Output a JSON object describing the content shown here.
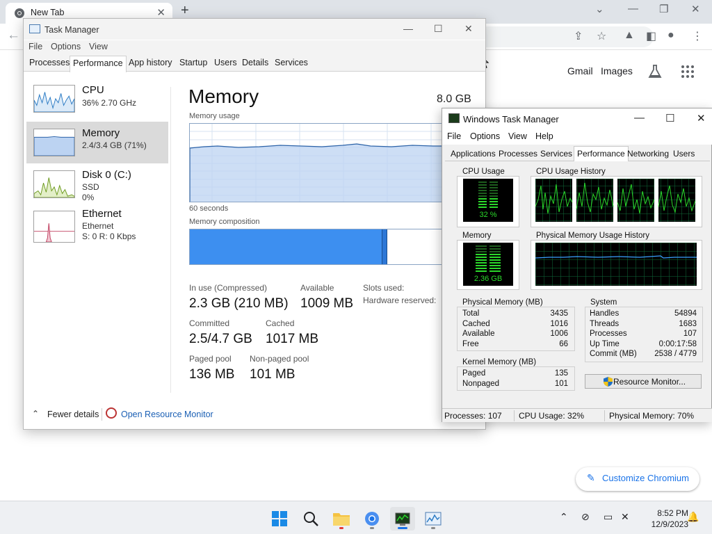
{
  "browser": {
    "tab_title": "New Tab",
    "gmail": "Gmail",
    "images": "Images",
    "customize": "Customize Chromium"
  },
  "taskbar": {
    "time": "8:52 PM",
    "date": "12/9/2023"
  },
  "tm": {
    "title": "Task Manager",
    "menu": [
      "File",
      "Options",
      "View"
    ],
    "tabs": [
      "Processes",
      "Performance",
      "App history",
      "Startup",
      "Users",
      "Details",
      "Services"
    ],
    "active_tab": "Performance",
    "sidebar": [
      {
        "name": "CPU",
        "line1": "36%  2.70 GHz",
        "line2": ""
      },
      {
        "name": "Memory",
        "line1": "2.4/3.4 GB (71%)",
        "line2": ""
      },
      {
        "name": "Disk 0 (C:)",
        "line1": "SSD",
        "line2": "0%"
      },
      {
        "name": "Ethernet",
        "line1": "Ethernet",
        "line2": "S: 0  R: 0 Kbps"
      }
    ],
    "memory": {
      "title": "Memory",
      "total": "8.0 GB",
      "usage_label": "Memory usage",
      "seconds_label": "60 seconds",
      "composition_label": "Memory composition",
      "in_use_label": "In use (Compressed)",
      "in_use_value": "2.3 GB (210 MB)",
      "available_label": "Available",
      "available_value": "1009 MB",
      "slots_label": "Slots used:",
      "hw_reserved_label": "Hardware reserved:",
      "committed_label": "Committed",
      "committed_value": "2.5/4.7 GB",
      "cached_label": "Cached",
      "cached_value": "1017 MB",
      "paged_label": "Paged pool",
      "paged_value": "136 MB",
      "nonpaged_label": "Non-paged pool",
      "nonpaged_value": "101 MB",
      "usage_level": 0.71
    },
    "footer": {
      "fewer": "Fewer details",
      "open_rm": "Open Resource Monitor"
    }
  },
  "wtm": {
    "title": "Windows Task Manager",
    "menu": [
      "File",
      "Options",
      "View",
      "Help"
    ],
    "tabs": [
      "Applications",
      "Processes",
      "Services",
      "Performance",
      "Networking",
      "Users"
    ],
    "active_tab": "Performance",
    "cpu_usage_label": "CPU Usage",
    "cpu_usage_value": "32 %",
    "cpu_history_label": "CPU Usage History",
    "memory_label": "Memory",
    "memory_value": "2.36 GB",
    "phys_history_label": "Physical Memory Usage History",
    "physical_memory": {
      "label": "Physical Memory (MB)",
      "rows": [
        {
          "k": "Total",
          "v": "3435"
        },
        {
          "k": "Cached",
          "v": "1016"
        },
        {
          "k": "Available",
          "v": "1006"
        },
        {
          "k": "Free",
          "v": "66"
        }
      ]
    },
    "kernel_memory": {
      "label": "Kernel Memory (MB)",
      "rows": [
        {
          "k": "Paged",
          "v": "135"
        },
        {
          "k": "Nonpaged",
          "v": "101"
        }
      ]
    },
    "system": {
      "label": "System",
      "rows": [
        {
          "k": "Handles",
          "v": "54894"
        },
        {
          "k": "Threads",
          "v": "1683"
        },
        {
          "k": "Processes",
          "v": "107"
        },
        {
          "k": "Up Time",
          "v": "0:00:17:58"
        },
        {
          "k": "Commit (MB)",
          "v": "2538 / 4779"
        }
      ]
    },
    "resource_monitor_btn": "Resource Monitor...",
    "status": {
      "processes": "Processes: 107",
      "cpu": "CPU Usage: 32%",
      "phys": "Physical Memory: 70%"
    }
  },
  "colors": {
    "mem_fill": "#bcd3f2",
    "mem_line": "#2b62a8",
    "inuse_bar": "#3d8ff0",
    "grid_green": "#0f6b3a",
    "led_green": "#2bd92b"
  }
}
